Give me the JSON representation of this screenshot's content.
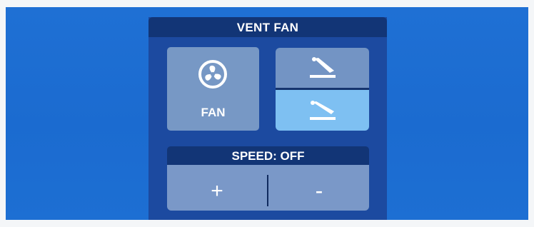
{
  "panel": {
    "title": "VENT FAN"
  },
  "fan_button": {
    "label": "FAN",
    "icon": "fan-icon"
  },
  "louver": {
    "up_icon": "louver-open-icon",
    "down_icon": "louver-closed-icon",
    "selected": "down"
  },
  "speed": {
    "label": "SPEED: OFF",
    "plus_label": "+",
    "minus_label": "-"
  },
  "colors": {
    "screen_bg": "#1f70d4",
    "panel_bg": "#1c4aa0",
    "header_bg": "#123576",
    "button_bg": "#7798c5",
    "selected_bg": "#7ec0f2"
  }
}
